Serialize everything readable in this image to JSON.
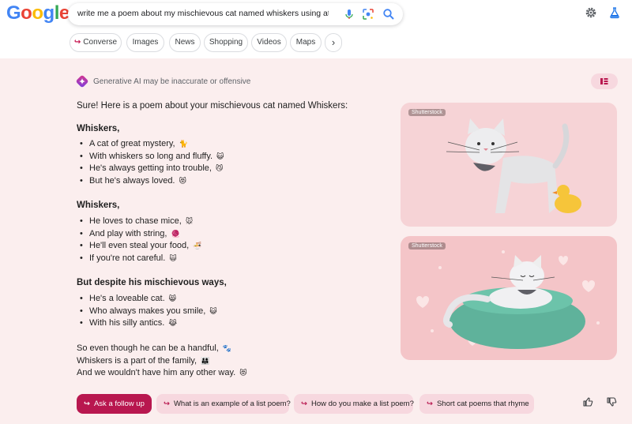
{
  "header": {
    "logo_letters": [
      "G",
      "o",
      "o",
      "g",
      "l",
      "e"
    ],
    "logo_colors": [
      "#4285f4",
      "#ea4335",
      "#fbbc05",
      "#4285f4",
      "#34a853",
      "#ea4335"
    ],
    "search_query": "write me a poem about my mischievous cat named whiskers using at least",
    "icons": [
      "mic-icon",
      "lens-icon",
      "search-icon",
      "gear-icon",
      "labs-flask-icon"
    ]
  },
  "chips": [
    {
      "label": "Converse",
      "arrow": "↪"
    },
    {
      "label": "Images"
    },
    {
      "label": "News"
    },
    {
      "label": "Shopping"
    },
    {
      "label": "Videos"
    },
    {
      "label": "Maps"
    },
    {
      "label": "›"
    }
  ],
  "ai": {
    "disclaimer": "Generative AI may be inaccurate or offensive",
    "intro": "Sure! Here is a poem about your mischievous cat named Whiskers:",
    "stanzas": [
      {
        "title": "Whiskers,",
        "lines": [
          {
            "text": "A cat of great mystery,",
            "emoji": "🐈"
          },
          {
            "text": "With whiskers so long and fluffy.",
            "emoji": "😺"
          },
          {
            "text": "He's always getting into trouble,",
            "emoji": "😼"
          },
          {
            "text": "But he's always loved.",
            "emoji": "😻"
          }
        ]
      },
      {
        "title": "Whiskers,",
        "lines": [
          {
            "text": "He loves to chase mice,",
            "emoji": "🐭"
          },
          {
            "text": "And play with string,",
            "emoji": "🧶"
          },
          {
            "text": "He'll even steal your food,",
            "emoji": "🍜"
          },
          {
            "text": "If you're not careful.",
            "emoji": "🙀"
          }
        ]
      },
      {
        "title": "But despite his mischievous ways,",
        "lines": [
          {
            "text": "He's a loveable cat.",
            "emoji": "😸"
          },
          {
            "text": "Who always makes you smile,",
            "emoji": "😺"
          },
          {
            "text": "With his silly antics.",
            "emoji": "😹"
          }
        ]
      }
    ],
    "closing": [
      {
        "text": "So even though he can be a handful,",
        "emoji": "🐾"
      },
      {
        "text": "Whiskers is a part of the family,",
        "emoji": "👨‍👩‍👧"
      },
      {
        "text": "And we wouldn't have him any other way.",
        "emoji": "😻"
      }
    ]
  },
  "images": [
    {
      "label": "Shutterstock",
      "bg": "#f6d3d6"
    },
    {
      "label": "Shutterstock",
      "bg": "#f4c5c8"
    }
  ],
  "followups": {
    "primary": {
      "label": "Ask a follow up",
      "arrow": "↪"
    },
    "suggestions": [
      {
        "label": "What is an example of a list poem?",
        "arrow": "↪"
      },
      {
        "label": "How do you make a list poem?",
        "arrow": "↪"
      },
      {
        "label": "Short cat poems that rhyme",
        "arrow": "↪"
      }
    ]
  },
  "colors": {
    "accent": "#b8174f",
    "surface": "#fbeeee",
    "chip_bg": "#f7d8df"
  }
}
